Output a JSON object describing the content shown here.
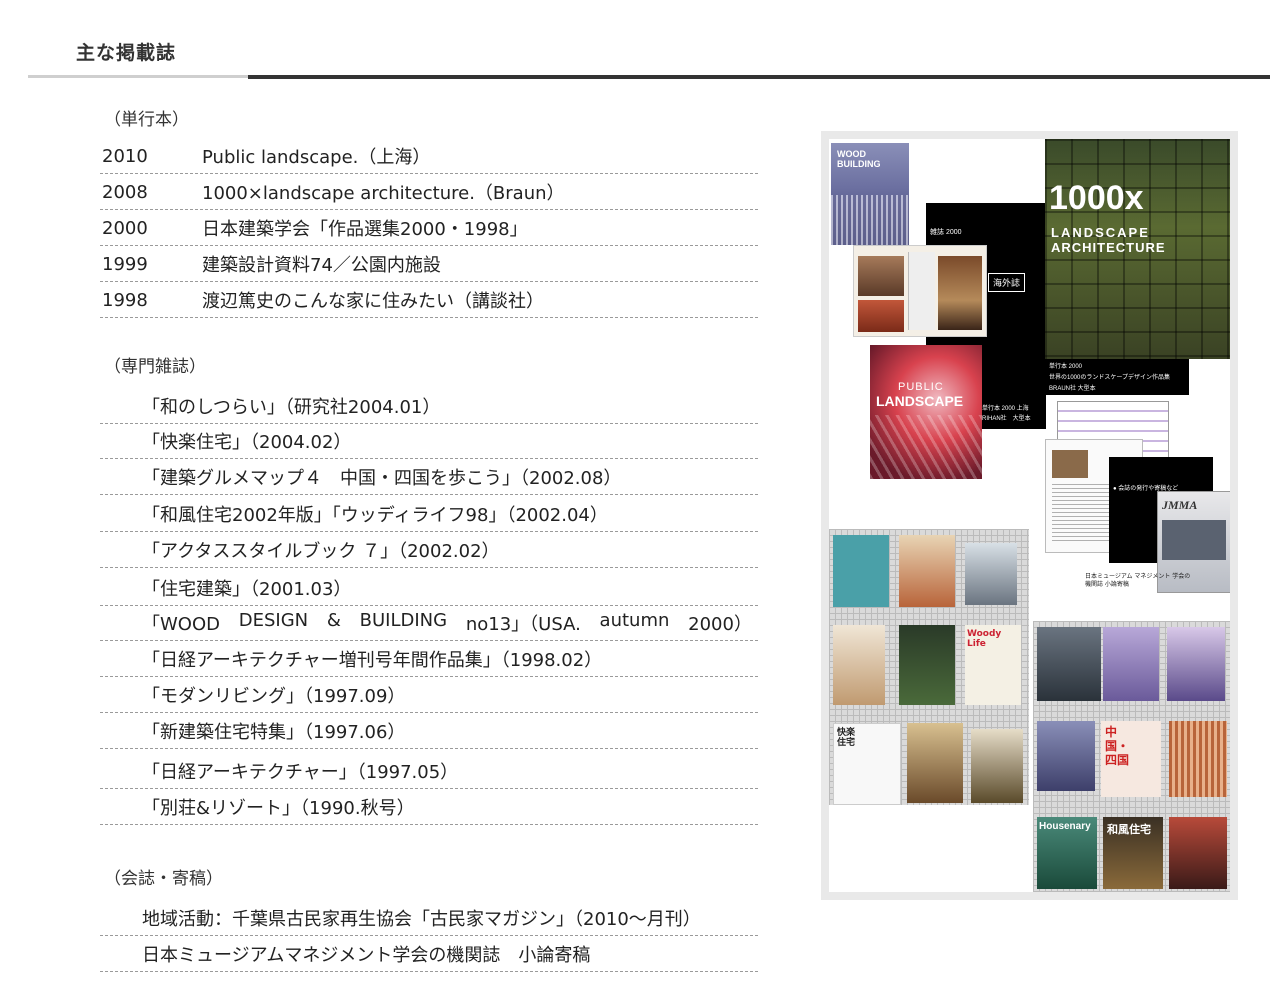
{
  "header": {
    "title": "主な掲載誌"
  },
  "sections": {
    "books": {
      "label": "（単行本）",
      "items": [
        {
          "year": "2010",
          "text": "Public landscape.（上海）"
        },
        {
          "year": "2008",
          "text": "1000×landscape architecture.（Braun）"
        },
        {
          "year": "2000",
          "text": "日本建築学会「作品選集2000・1998」"
        },
        {
          "year": "1999",
          "text": "建築設計資料74／公園内施設"
        },
        {
          "year": "1998",
          "text": "渡辺篤史のこんな家に住みたい（講談社）"
        }
      ]
    },
    "magazines": {
      "label": "（専門雑誌）",
      "items": [
        "「和のしつらい」（研究社2004.01）",
        "「快楽住宅」（2004.02）",
        "「建築グルメマップ４　中国・四国を歩こう」（2002.08）",
        "「和風住宅2002年版」「ウッディライフ98」（2002.04）",
        "「アクタススタイルブック ７」（2002.02）",
        "「住宅建築」（2001.03）",
        "「WOOD DESIGN & BUILDING no13」（USA. autumn 2000）",
        "「日経アーキテクチャー増刊号年間作品集」（1998.02）",
        "「モダンリビング」（1997.09）",
        "「新建築住宅特集」（1997.06）",
        "「日経アーキテクチャー」（1997.05）",
        "「別荘&リゾート」（1990.秋号）"
      ],
      "justified_words": [
        "「WOOD",
        "DESIGN",
        "&",
        "BUILDING",
        "no13」（USA.",
        "autumn",
        "2000）"
      ]
    },
    "contributions": {
      "label": "（会誌・寄稿）",
      "items": [
        "地域活動：千葉県古民家再生協会「古民家マガジン」（2010～月刊）",
        "日本ミュージアムマネジメント学会の機関誌　小論寄稿"
      ]
    }
  },
  "collage": {
    "cover_1000x_title": "1000x",
    "cover_1000x_sub1": "LANDSCAPE",
    "cover_1000x_sub2": "ARCHITECTURE",
    "public_landscape_1": "PUBLIC",
    "public_landscape_2": "LANDSCAPE",
    "wood_building": "WOOD BUILDING",
    "kaigai_label": "海外誌",
    "black_label_1": "雑誌 2000",
    "black_label_2": "単行本 2000 上海",
    "black_label_3": "RIHAN社　大型本",
    "black_label_4": "単行本 2000",
    "black_label_5": "世界の1000のランドスケープデザイン作品集",
    "black_label_6": "BRAUN社 大型本",
    "caption_kai": "● 会誌の発行や寄稿など",
    "jmma": "JMMA",
    "jmma_caption": "日本ミュージアム マネジメント 学会の機関誌 小論寄稿",
    "housenary": "Housenary",
    "wafu": "和風住宅",
    "chugoku": "中国・四国",
    "kairaku": "快楽住宅",
    "woody": "Woody Life"
  }
}
